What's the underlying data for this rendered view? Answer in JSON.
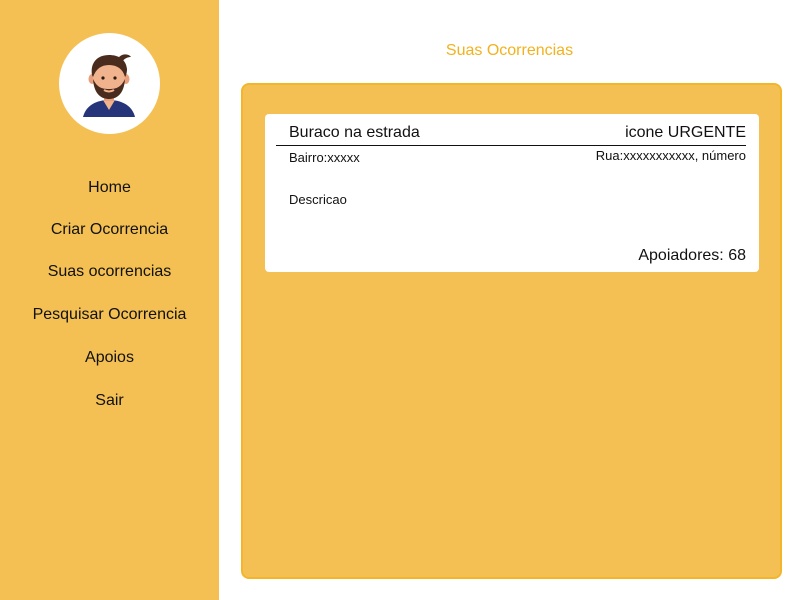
{
  "colors": {
    "sidebar_bg": "#f4c053",
    "accent": "#f2b21e",
    "panel_border": "#f3b62a",
    "card_bg": "#ffffff"
  },
  "sidebar": {
    "avatar_icon": "user-avatar-icon",
    "items": [
      {
        "label": "Home"
      },
      {
        "label": "Criar Ocorrencia"
      },
      {
        "label": "Suas ocorrencias"
      },
      {
        "label": "Pesquisar Ocorrencia"
      },
      {
        "label": "Apoios"
      },
      {
        "label": "Sair"
      }
    ]
  },
  "main": {
    "title": "Suas Ocorrencias",
    "occurrences": [
      {
        "title": "Buraco na estrada",
        "urgency": "icone URGENTE",
        "bairro": "Bairro:xxxxx",
        "rua": "Rua:xxxxxxxxxxx, número",
        "descricao": "Descricao",
        "apoiadores": "Apoiadores: 68"
      }
    ]
  }
}
